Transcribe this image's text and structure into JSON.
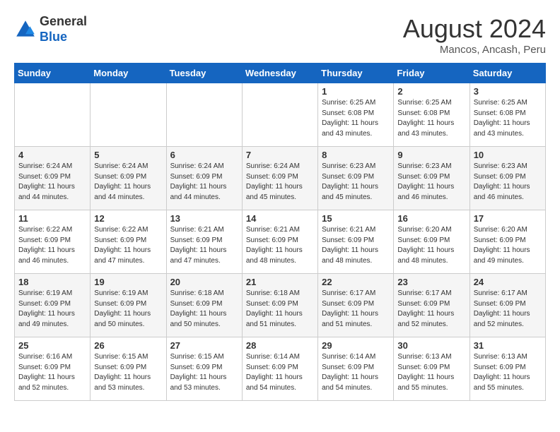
{
  "header": {
    "logo_general": "General",
    "logo_blue": "Blue",
    "month_year": "August 2024",
    "location": "Mancos, Ancash, Peru"
  },
  "weekdays": [
    "Sunday",
    "Monday",
    "Tuesday",
    "Wednesday",
    "Thursday",
    "Friday",
    "Saturday"
  ],
  "weeks": [
    [
      {
        "day": "",
        "info": ""
      },
      {
        "day": "",
        "info": ""
      },
      {
        "day": "",
        "info": ""
      },
      {
        "day": "",
        "info": ""
      },
      {
        "day": "1",
        "info": "Sunrise: 6:25 AM\nSunset: 6:08 PM\nDaylight: 11 hours\nand 43 minutes."
      },
      {
        "day": "2",
        "info": "Sunrise: 6:25 AM\nSunset: 6:08 PM\nDaylight: 11 hours\nand 43 minutes."
      },
      {
        "day": "3",
        "info": "Sunrise: 6:25 AM\nSunset: 6:08 PM\nDaylight: 11 hours\nand 43 minutes."
      }
    ],
    [
      {
        "day": "4",
        "info": "Sunrise: 6:24 AM\nSunset: 6:09 PM\nDaylight: 11 hours\nand 44 minutes."
      },
      {
        "day": "5",
        "info": "Sunrise: 6:24 AM\nSunset: 6:09 PM\nDaylight: 11 hours\nand 44 minutes."
      },
      {
        "day": "6",
        "info": "Sunrise: 6:24 AM\nSunset: 6:09 PM\nDaylight: 11 hours\nand 44 minutes."
      },
      {
        "day": "7",
        "info": "Sunrise: 6:24 AM\nSunset: 6:09 PM\nDaylight: 11 hours\nand 45 minutes."
      },
      {
        "day": "8",
        "info": "Sunrise: 6:23 AM\nSunset: 6:09 PM\nDaylight: 11 hours\nand 45 minutes."
      },
      {
        "day": "9",
        "info": "Sunrise: 6:23 AM\nSunset: 6:09 PM\nDaylight: 11 hours\nand 46 minutes."
      },
      {
        "day": "10",
        "info": "Sunrise: 6:23 AM\nSunset: 6:09 PM\nDaylight: 11 hours\nand 46 minutes."
      }
    ],
    [
      {
        "day": "11",
        "info": "Sunrise: 6:22 AM\nSunset: 6:09 PM\nDaylight: 11 hours\nand 46 minutes."
      },
      {
        "day": "12",
        "info": "Sunrise: 6:22 AM\nSunset: 6:09 PM\nDaylight: 11 hours\nand 47 minutes."
      },
      {
        "day": "13",
        "info": "Sunrise: 6:21 AM\nSunset: 6:09 PM\nDaylight: 11 hours\nand 47 minutes."
      },
      {
        "day": "14",
        "info": "Sunrise: 6:21 AM\nSunset: 6:09 PM\nDaylight: 11 hours\nand 48 minutes."
      },
      {
        "day": "15",
        "info": "Sunrise: 6:21 AM\nSunset: 6:09 PM\nDaylight: 11 hours\nand 48 minutes."
      },
      {
        "day": "16",
        "info": "Sunrise: 6:20 AM\nSunset: 6:09 PM\nDaylight: 11 hours\nand 48 minutes."
      },
      {
        "day": "17",
        "info": "Sunrise: 6:20 AM\nSunset: 6:09 PM\nDaylight: 11 hours\nand 49 minutes."
      }
    ],
    [
      {
        "day": "18",
        "info": "Sunrise: 6:19 AM\nSunset: 6:09 PM\nDaylight: 11 hours\nand 49 minutes."
      },
      {
        "day": "19",
        "info": "Sunrise: 6:19 AM\nSunset: 6:09 PM\nDaylight: 11 hours\nand 50 minutes."
      },
      {
        "day": "20",
        "info": "Sunrise: 6:18 AM\nSunset: 6:09 PM\nDaylight: 11 hours\nand 50 minutes."
      },
      {
        "day": "21",
        "info": "Sunrise: 6:18 AM\nSunset: 6:09 PM\nDaylight: 11 hours\nand 51 minutes."
      },
      {
        "day": "22",
        "info": "Sunrise: 6:17 AM\nSunset: 6:09 PM\nDaylight: 11 hours\nand 51 minutes."
      },
      {
        "day": "23",
        "info": "Sunrise: 6:17 AM\nSunset: 6:09 PM\nDaylight: 11 hours\nand 52 minutes."
      },
      {
        "day": "24",
        "info": "Sunrise: 6:17 AM\nSunset: 6:09 PM\nDaylight: 11 hours\nand 52 minutes."
      }
    ],
    [
      {
        "day": "25",
        "info": "Sunrise: 6:16 AM\nSunset: 6:09 PM\nDaylight: 11 hours\nand 52 minutes."
      },
      {
        "day": "26",
        "info": "Sunrise: 6:15 AM\nSunset: 6:09 PM\nDaylight: 11 hours\nand 53 minutes."
      },
      {
        "day": "27",
        "info": "Sunrise: 6:15 AM\nSunset: 6:09 PM\nDaylight: 11 hours\nand 53 minutes."
      },
      {
        "day": "28",
        "info": "Sunrise: 6:14 AM\nSunset: 6:09 PM\nDaylight: 11 hours\nand 54 minutes."
      },
      {
        "day": "29",
        "info": "Sunrise: 6:14 AM\nSunset: 6:09 PM\nDaylight: 11 hours\nand 54 minutes."
      },
      {
        "day": "30",
        "info": "Sunrise: 6:13 AM\nSunset: 6:09 PM\nDaylight: 11 hours\nand 55 minutes."
      },
      {
        "day": "31",
        "info": "Sunrise: 6:13 AM\nSunset: 6:09 PM\nDaylight: 11 hours\nand 55 minutes."
      }
    ]
  ]
}
